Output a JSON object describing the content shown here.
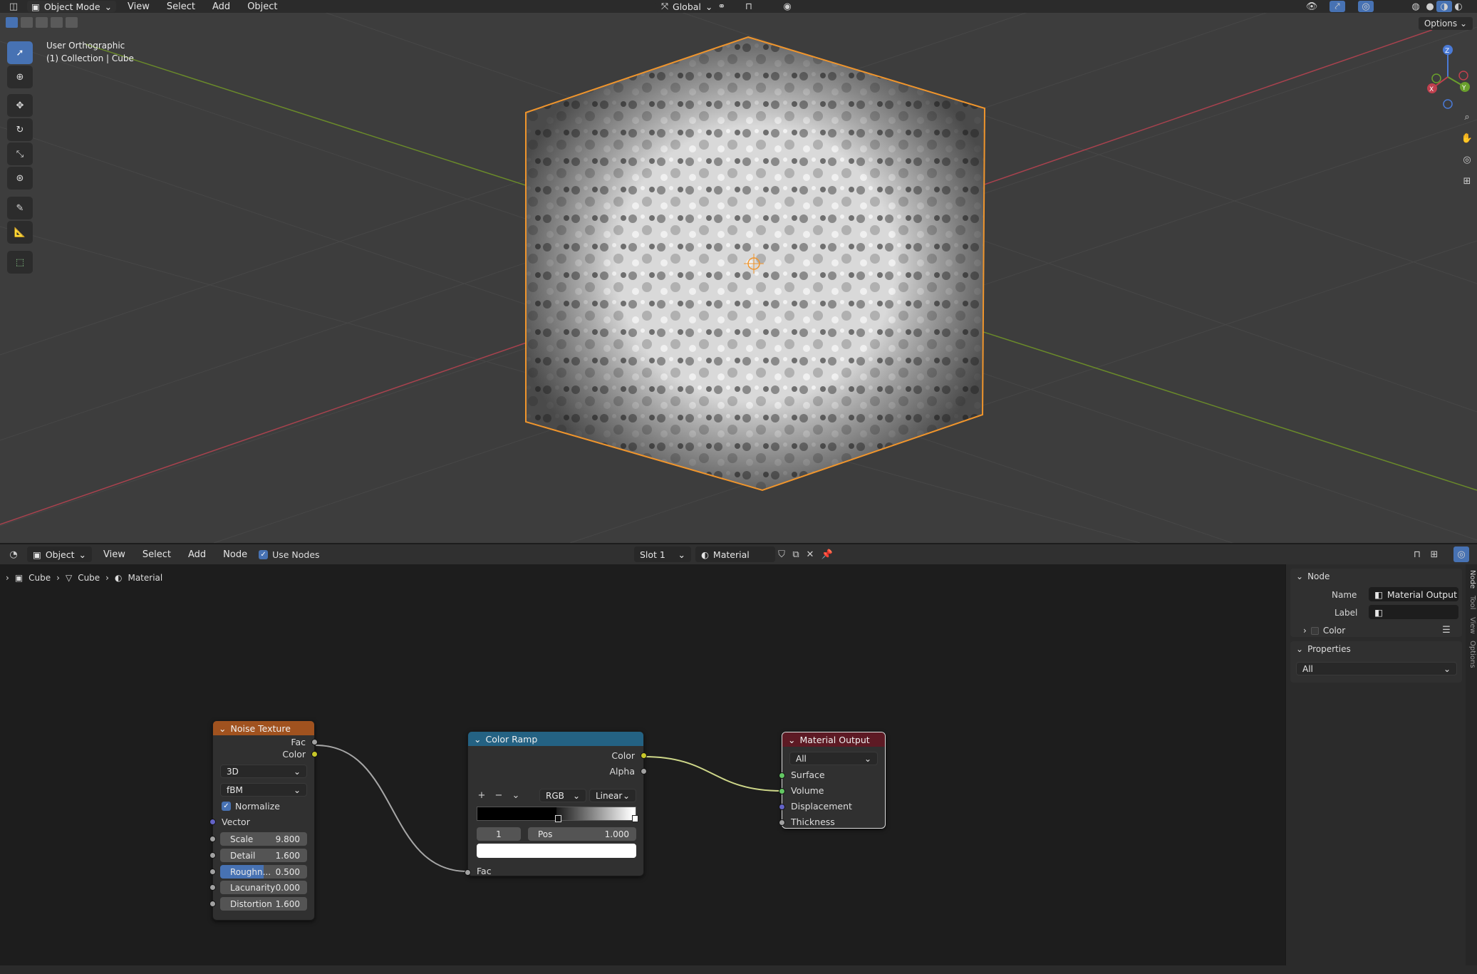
{
  "top_header": {
    "mode_label": "Object Mode",
    "menus": [
      "View",
      "Select",
      "Add",
      "Object"
    ],
    "transform_orientation": "Global",
    "options_label": "Options"
  },
  "viewport": {
    "view_name": "User Orthographic",
    "collection_info": "(1) Collection | Cube",
    "gizmo_axes": {
      "z": "Z",
      "y": "Y",
      "x": "X"
    },
    "colors": {
      "selection_outline": "#f0952c",
      "x_axis": "#b84a57",
      "y_axis": "#6e8a2e",
      "grid": "#4a4a4a",
      "background": "#3d3d3d"
    }
  },
  "node_header": {
    "type_label": "Object",
    "menus": [
      "View",
      "Select",
      "Add",
      "Node"
    ],
    "use_nodes_label": "Use Nodes",
    "slot_label": "Slot 1",
    "material_name": "Material"
  },
  "breadcrumb": {
    "items": [
      "Cube",
      "Cube",
      "Material"
    ]
  },
  "nodes": {
    "noise": {
      "title": "Noise Texture",
      "outputs": [
        "Fac",
        "Color"
      ],
      "dimensions": "3D",
      "noise_type": "fBM",
      "normalize_label": "Normalize",
      "vector_label": "Vector",
      "fields": [
        {
          "label": "Scale",
          "value": "9.800"
        },
        {
          "label": "Detail",
          "value": "1.600"
        },
        {
          "label": "Roughn...",
          "value": "0.500"
        },
        {
          "label": "Lacunarity",
          "value": "0.000"
        },
        {
          "label": "Distortion",
          "value": "1.600"
        }
      ],
      "roughness_fill": 0.5,
      "color": "#a0521f"
    },
    "ramp": {
      "title": "Color Ramp",
      "outputs": [
        "Color",
        "Alpha"
      ],
      "color_mode": "RGB",
      "interpolation": "Linear",
      "stop_index": "1",
      "pos_label": "Pos",
      "pos_value": "1.000",
      "input": "Fac",
      "color": "#246283"
    },
    "output": {
      "title": "Material Output",
      "target": "All",
      "inputs": [
        "Surface",
        "Volume",
        "Displacement",
        "Thickness"
      ],
      "color": "#5d1a24"
    }
  },
  "sidebar": {
    "panel_title": "Node",
    "name_label": "Name",
    "name_value": "Material Output",
    "label_label": "Label",
    "label_value": "",
    "color_label": "Color",
    "properties_title": "Properties",
    "properties_value": "All",
    "tabs": [
      "Node",
      "Tool",
      "View",
      "Options"
    ]
  }
}
